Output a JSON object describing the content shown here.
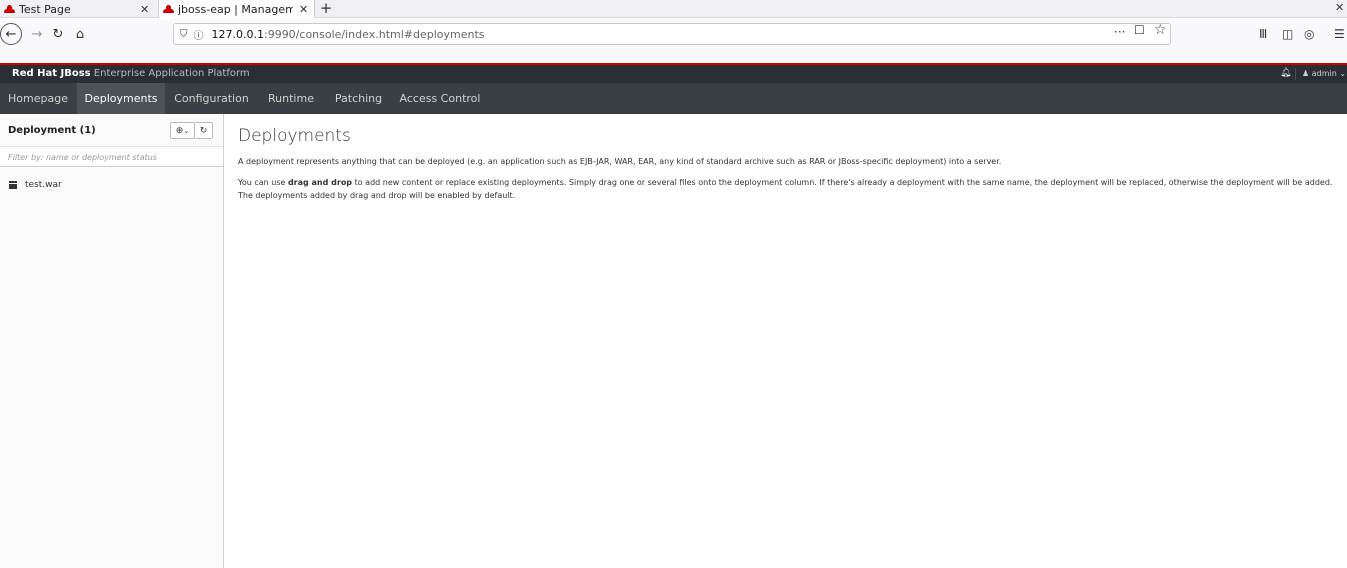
{
  "browser": {
    "tabs": [
      {
        "title": "Test Page",
        "active": false
      },
      {
        "title": "jboss-eap | Management",
        "active": true
      }
    ],
    "url_host": "127.0.0.1",
    "url_rest": ":9990/console/index.html#deployments",
    "icons": [
      "back-icon",
      "forward-icon",
      "reload-icon",
      "home-icon",
      "shield-icon",
      "info-icon",
      "more-icon",
      "pocket-icon",
      "star-icon",
      "library-icon",
      "sidebar-icon",
      "account-icon",
      "menu-icon"
    ]
  },
  "header": {
    "brand_bold": "Red Hat JBoss",
    "brand_light": " Enterprise Application Platform",
    "user": "admin"
  },
  "nav": {
    "items": [
      "Homepage",
      "Deployments",
      "Configuration",
      "Runtime",
      "Patching",
      "Access Control"
    ],
    "active": "Deployments"
  },
  "sidebar": {
    "title": "Deployment (1)",
    "filter_placeholder": "Filter by: name or deployment status",
    "items": [
      "test.war"
    ]
  },
  "main": {
    "title": "Deployments",
    "desc1": "A deployment represents anything that can be deployed (e.g. an application such as EJB-JAR, WAR, EAR, any kind of standard archive such as RAR or JBoss-specific deployment) into a server.",
    "desc2_pre": "You can use ",
    "desc2_bold": "drag and drop",
    "desc2_post": " to add new content or replace existing deployments. Simply drag one or several files onto the deployment column. If there's already a deployment with the same name, the deployment will be replaced, otherwise the deployment will be added. The deployments added by drag and drop will be enabled by default."
  },
  "colors": {
    "brand_bar": "#292e34",
    "nav_bar": "#393f44",
    "nav_active": "#4d5258",
    "accent_red": "#cc0000"
  }
}
